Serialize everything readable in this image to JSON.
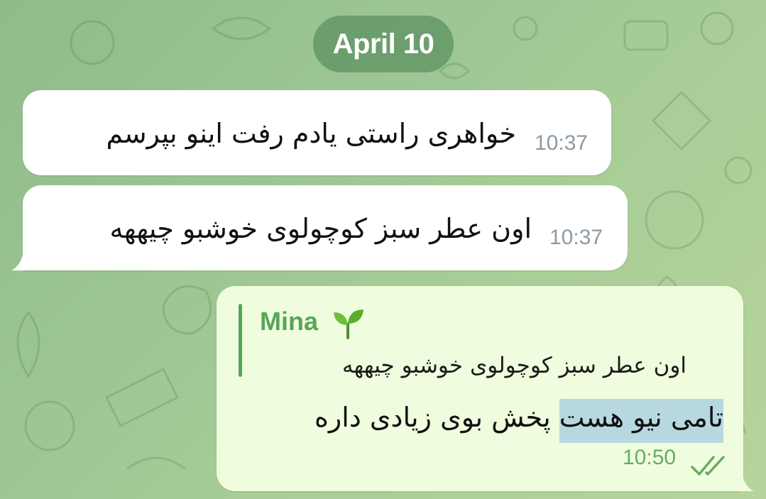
{
  "date_separator": "April 10",
  "messages": [
    {
      "direction": "incoming",
      "text": "خواهری راستی یادم رفت اینو بپرسم",
      "time": "10:37"
    },
    {
      "direction": "incoming",
      "text": "اون عطر سبز کوچولوی خوشبو چیههه",
      "time": "10:37"
    },
    {
      "direction": "outgoing",
      "reply": {
        "name": "Mina",
        "name_emoji": "seedling-icon",
        "text": "اون عطر سبز کوچولوی خوشبو چیههه"
      },
      "text_highlighted": "تامی نیو هست",
      "text_rest": " پخش بوی زیادی داره",
      "time": "10:50",
      "status_icon": "double-check-icon"
    }
  ],
  "colors": {
    "incoming_bubble": "#ffffff",
    "outgoing_bubble": "#effdde",
    "accent_green": "#58a55a",
    "highlight": "#b8d8e0"
  }
}
